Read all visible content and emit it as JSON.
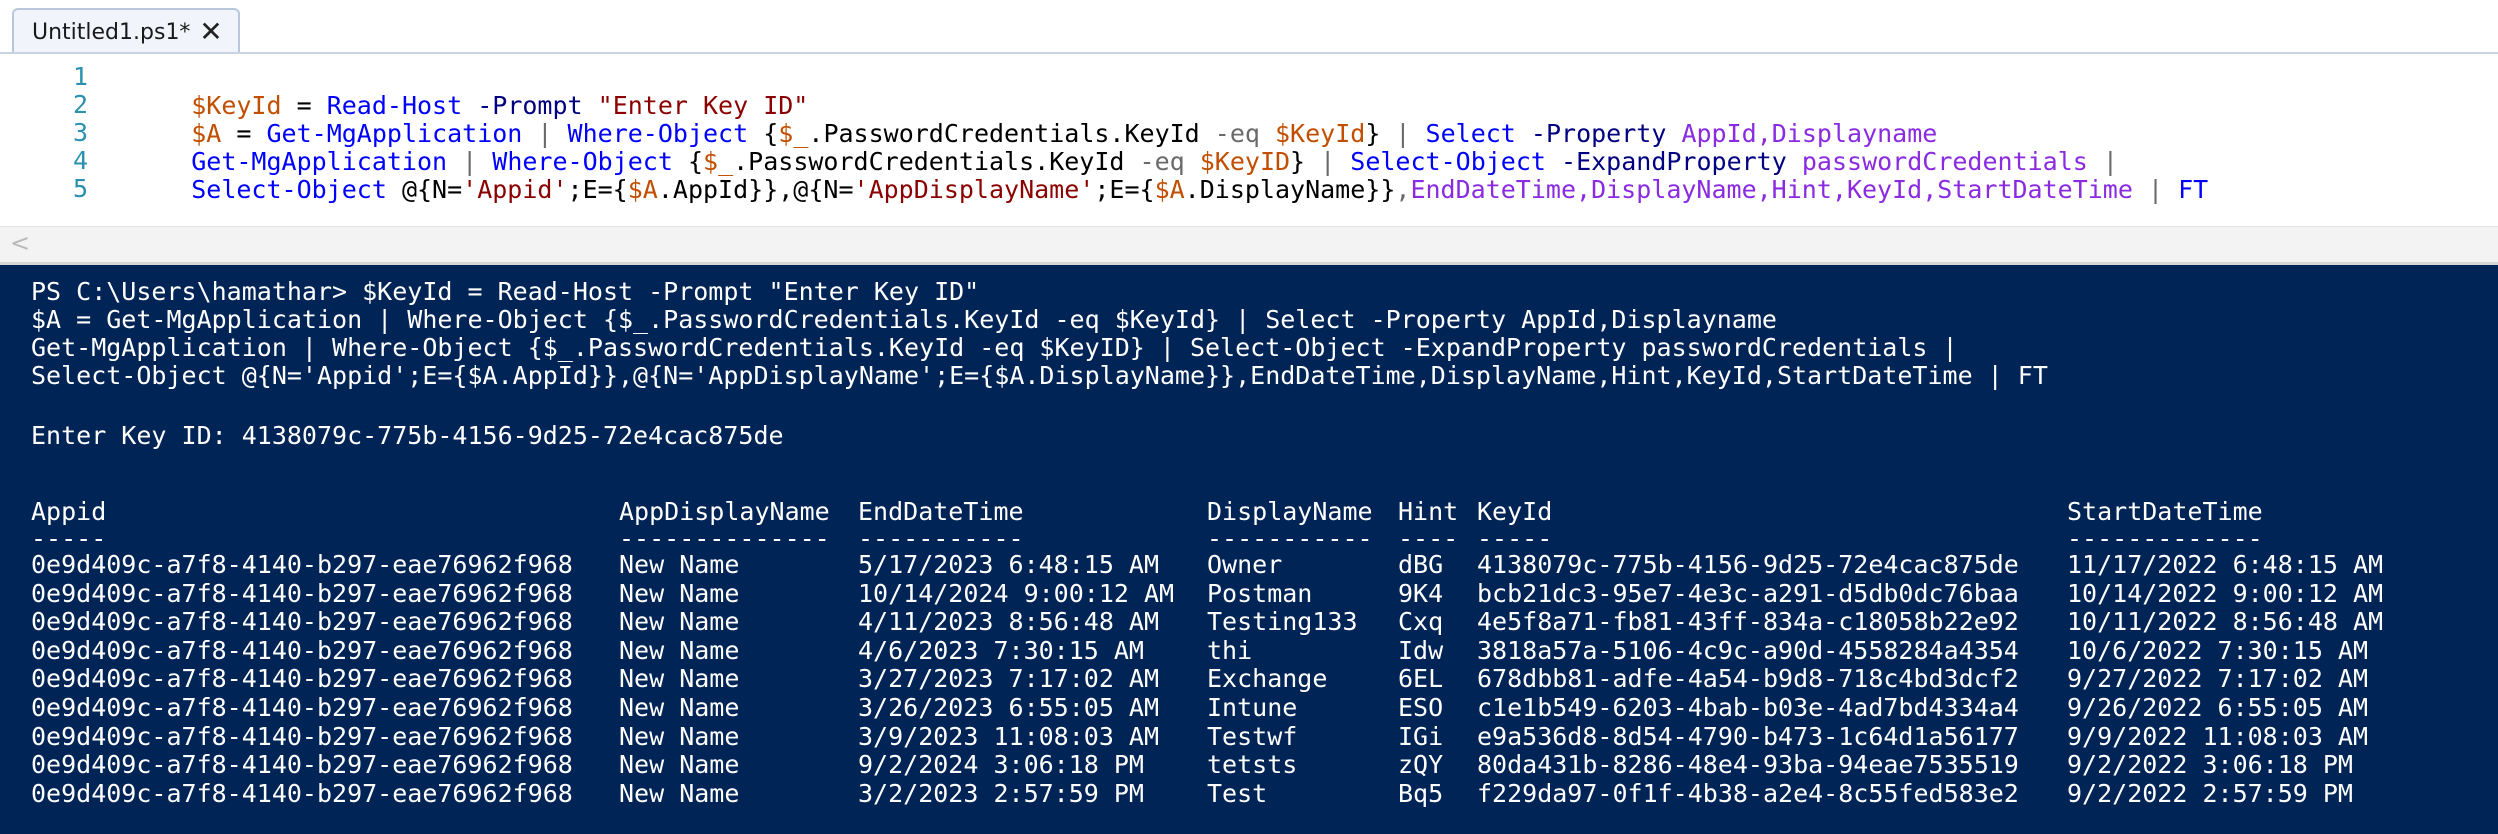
{
  "tab": {
    "title": "Untitled1.ps1*",
    "close_glyph": "✕"
  },
  "editor": {
    "lines": [
      {
        "number": "1"
      },
      {
        "number": "2"
      },
      {
        "number": "3"
      },
      {
        "number": "4"
      },
      {
        "number": "5"
      }
    ],
    "line1": [
      "$KeyId",
      " = ",
      "Read-Host",
      " ",
      "-Prompt",
      " ",
      "\"Enter Key ID\""
    ],
    "line2": [
      "$A",
      " = ",
      "Get-MgApplication",
      " ",
      "|",
      " ",
      "Where-Object",
      " {",
      "$_",
      ".PasswordCredentials.KeyId ",
      "-eq",
      " ",
      "$KeyId",
      "} ",
      "|",
      " ",
      "Select",
      " ",
      "-Property",
      " ",
      "AppId,Displayname"
    ],
    "line3": [
      "Get-MgApplication",
      " ",
      "|",
      " ",
      "Where-Object",
      " {",
      "$_",
      ".PasswordCredentials.KeyId ",
      "-eq",
      " ",
      "$KeyID",
      "} ",
      "|",
      " ",
      "Select-Object",
      " ",
      "-ExpandProperty",
      " ",
      "passwordCredentials",
      " ",
      "|"
    ],
    "line4": [
      "Select-Object",
      " @{N=",
      "'Appid'",
      ";E={",
      "$A",
      ".AppId}},@{N=",
      "'AppDisplayName'",
      ";E={",
      "$A",
      ".DisplayName}}",
      ",",
      "EndDateTime,DisplayName,Hint,KeyId,StartDateTime",
      " ",
      "|",
      " ",
      "FT"
    ],
    "scroll_arrow": "<"
  },
  "console": {
    "command_lines": [
      "PS C:\\Users\\hamathar> $KeyId = Read-Host -Prompt \"Enter Key ID\"",
      "$A = Get-MgApplication | Where-Object {$_.PasswordCredentials.KeyId -eq $KeyId} | Select -Property AppId,Displayname",
      "Get-MgApplication | Where-Object {$_.PasswordCredentials.KeyId -eq $KeyID} | Select-Object -ExpandProperty passwordCredentials |",
      "Select-Object @{N='Appid';E={$A.AppId}},@{N='AppDisplayName';E={$A.DisplayName}},EndDateTime,DisplayName,Hint,KeyId,StartDateTime | FT"
    ],
    "prompt_line": "Enter Key ID: 4138079c-775b-4156-9d25-72e4cac875de",
    "table": {
      "headers": [
        "Appid",
        "AppDisplayName",
        "EndDateTime",
        "DisplayName",
        "Hint",
        "KeyId",
        "StartDateTime"
      ],
      "underlines": [
        "-----",
        "--------------",
        "-----------",
        "-----------",
        "----",
        "-----",
        "-------------"
      ],
      "rows": [
        [
          "0e9d409c-a7f8-4140-b297-eae76962f968",
          "New Name",
          "5/17/2023 6:48:15 AM",
          "Owner",
          "dBG",
          "4138079c-775b-4156-9d25-72e4cac875de",
          "11/17/2022 6:48:15 AM"
        ],
        [
          "0e9d409c-a7f8-4140-b297-eae76962f968",
          "New Name",
          "10/14/2024 9:00:12 AM",
          "Postman",
          "9K4",
          "bcb21dc3-95e7-4e3c-a291-d5db0dc76baa",
          "10/14/2022 9:00:12 AM"
        ],
        [
          "0e9d409c-a7f8-4140-b297-eae76962f968",
          "New Name",
          "4/11/2023 8:56:48 AM",
          "Testing133",
          "Cxq",
          "4e5f8a71-fb81-43ff-834a-c18058b22e92",
          "10/11/2022 8:56:48 AM"
        ],
        [
          "0e9d409c-a7f8-4140-b297-eae76962f968",
          "New Name",
          "4/6/2023 7:30:15 AM",
          "thi",
          "Idw",
          "3818a57a-5106-4c9c-a90d-4558284a4354",
          "10/6/2022 7:30:15 AM"
        ],
        [
          "0e9d409c-a7f8-4140-b297-eae76962f968",
          "New Name",
          "3/27/2023 7:17:02 AM",
          "Exchange",
          "6EL",
          "678dbb81-adfe-4a54-b9d8-718c4bd3dcf2",
          "9/27/2022 7:17:02 AM"
        ],
        [
          "0e9d409c-a7f8-4140-b297-eae76962f968",
          "New Name",
          "3/26/2023 6:55:05 AM",
          "Intune",
          "ESO",
          "c1e1b549-6203-4bab-b03e-4ad7bd4334a4",
          "9/26/2022 6:55:05 AM"
        ],
        [
          "0e9d409c-a7f8-4140-b297-eae76962f968",
          "New Name",
          "3/9/2023 11:08:03 AM",
          "Testwf",
          "IGi",
          "e9a536d8-8d54-4790-b473-1c64d1a56177",
          "9/9/2022 11:08:03 AM"
        ],
        [
          "0e9d409c-a7f8-4140-b297-eae76962f968",
          "New Name",
          "9/2/2024 3:06:18 PM",
          "tetsts",
          "zQY",
          "80da431b-8286-48e4-93ba-94eae7535519",
          "9/2/2022 3:06:18 PM"
        ],
        [
          "0e9d409c-a7f8-4140-b297-eae76962f968",
          "New Name",
          "3/2/2023 2:57:59 PM",
          "Test",
          "Bq5",
          "f229da97-0f1f-4b38-a2e4-8c55fed583e2",
          "9/2/2022 2:57:59 PM"
        ]
      ]
    }
  },
  "colors": {
    "console_background": "#012456",
    "variable": "#c24e00",
    "command": "#0000ff",
    "parameter": "#000080",
    "string": "#8b0000",
    "argument": "#8a2be2",
    "line_number": "#2b91af"
  }
}
